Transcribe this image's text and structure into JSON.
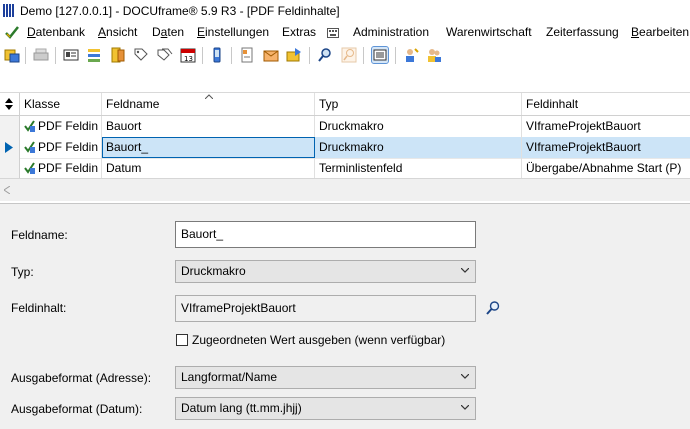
{
  "window": {
    "title": "Demo [127.0.0.1] - DOCUframe® 5.9 R3 - [PDF Feldinhalte]"
  },
  "menu": {
    "items": [
      {
        "accel": "D",
        "rest": "atenbank"
      },
      {
        "accel": "A",
        "rest": "nsicht"
      },
      {
        "accel": "D",
        "rest": "aten",
        "pre": "D",
        "full": "Daten"
      },
      {
        "accel": "E",
        "rest": "instellungen"
      },
      {
        "accel": "",
        "rest": "Extras"
      },
      {
        "accel": "",
        "rest": "Administration"
      },
      {
        "accel": "",
        "rest": "Warenwirtschaft"
      },
      {
        "accel": "",
        "rest": "Zeiterfassung"
      },
      {
        "accel": "B",
        "rest": "earbeiten"
      }
    ],
    "labels": [
      "Datenbank",
      "Ansicht",
      "Daten",
      "Einstellungen",
      "Extras",
      "Administration",
      "Warenwirtschaft",
      "Zeiterfassung",
      "Bearbeiten"
    ]
  },
  "grid": {
    "columns": [
      "Klasse",
      "Feldname",
      "Typ",
      "Feldinhalt"
    ],
    "rows": [
      {
        "klasse": "PDF Feldin",
        "feldname": "Bauort",
        "typ": "Druckmakro",
        "feldinhalt": "VIframeProjektBauort"
      },
      {
        "klasse": "PDF Feldin",
        "feldname": "Bauort_",
        "typ": "Druckmakro",
        "feldinhalt": "VIframeProjektBauort"
      },
      {
        "klasse": "PDF Feldin",
        "feldname": "Datum",
        "typ": "Terminlistenfeld",
        "feldinhalt": "Übergabe/Abnahme Start (P)"
      }
    ],
    "selected_row": 1
  },
  "form": {
    "feldname_label": "Feldname:",
    "feldname_value": "Bauort_",
    "typ_label": "Typ:",
    "typ_value": "Druckmakro",
    "feldinhalt_label": "Feldinhalt:",
    "feldinhalt_value": "VIframeProjektBauort",
    "checkbox_label": "Zugeordneten Wert ausgeben (wenn verfügbar)",
    "checkbox_checked": false,
    "adresse_label": "Ausgabeformat (Adresse):",
    "adresse_value": "Langformat/Name",
    "datum_label": "Ausgabeformat (Datum):",
    "datum_value": "Datum lang (tt.mm.jhjj)"
  },
  "colors": {
    "selection": "#cce4f7",
    "form_bg": "#f0f0f0",
    "arrow": "#0063b1"
  }
}
